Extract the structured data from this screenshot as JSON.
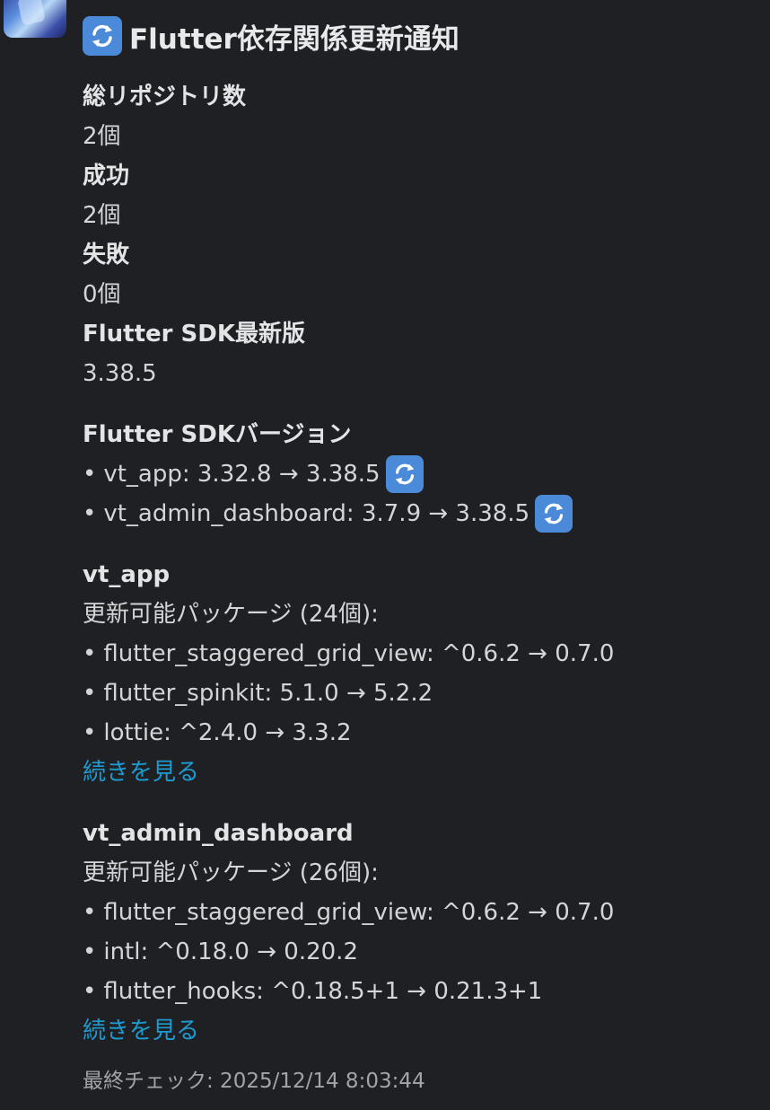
{
  "message": {
    "icon": "sync-arrows-icon",
    "title": "Flutter依存関係更新通知",
    "summary": [
      {
        "label": "総リポジトリ数",
        "value": "2個"
      },
      {
        "label": "成功",
        "value": "2個"
      },
      {
        "label": "失敗",
        "value": "0個"
      },
      {
        "label": "Flutter SDK最新版",
        "value": "3.38.5"
      }
    ],
    "sdk_section": {
      "heading": "Flutter SDKバージョン",
      "items": [
        {
          "text": "vt_app: 3.32.8 → 3.38.5"
        },
        {
          "text": "vt_admin_dashboard: 3.7.9 → 3.38.5"
        }
      ]
    },
    "repos": [
      {
        "name": "vt_app",
        "subtitle": "更新可能パッケージ (24個):",
        "packages": [
          "flutter_staggered_grid_view: ^0.6.2 → 0.7.0",
          "flutter_spinkit: 5.1.0 → 5.2.2",
          "lottie: ^2.4.0 → 3.3.2"
        ],
        "more_link": "続きを見る"
      },
      {
        "name": "vt_admin_dashboard",
        "subtitle": "更新可能パッケージ (26個):",
        "packages": [
          "flutter_staggered_grid_view: ^0.6.2 → 0.7.0",
          "intl: ^0.18.0 → 0.20.2",
          "flutter_hooks: ^0.18.5+1 → 0.21.3+1"
        ],
        "more_link": "続きを見る"
      }
    ],
    "footer": "最終チェック: 2025/12/14 8:03:44",
    "bullet_char": "•"
  },
  "colors": {
    "background": "#1f2024",
    "text": "#d4d5d7",
    "link": "#1d9bd1",
    "icon_bg": "#4a8ad8"
  }
}
